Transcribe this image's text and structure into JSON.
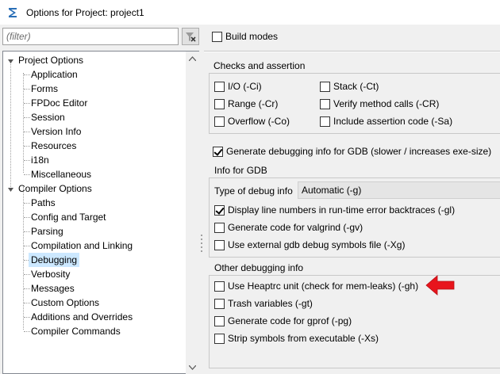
{
  "window": {
    "title": "Options for Project: project1"
  },
  "filter": {
    "placeholder": "(filter)"
  },
  "tree": {
    "project_options": "Project Options",
    "project_children": [
      "Application",
      "Forms",
      "FPDoc Editor",
      "Session",
      "Version Info",
      "Resources",
      "i18n",
      "Miscellaneous"
    ],
    "compiler_options": "Compiler Options",
    "compiler_children": [
      "Paths",
      "Config and Target",
      "Parsing",
      "Compilation and Linking",
      "Debugging",
      "Verbosity",
      "Messages",
      "Custom Options",
      "Additions and Overrides",
      "Compiler Commands"
    ],
    "selected": "Debugging"
  },
  "build_modes": {
    "label": "Build modes",
    "checked": false
  },
  "checks": {
    "title": "Checks and assertion",
    "io": {
      "label": "I/O (-Ci)",
      "checked": false
    },
    "range": {
      "label": "Range (-Cr)",
      "checked": false
    },
    "overflow": {
      "label": "Overflow (-Co)",
      "checked": false
    },
    "stack": {
      "label": "Stack (-Ct)",
      "checked": false
    },
    "verify": {
      "label": "Verify method calls (-CR)",
      "checked": false
    },
    "assertion": {
      "label": "Include assertion code (-Sa)",
      "checked": false
    }
  },
  "gen_debug": {
    "label": "Generate debugging info for GDB (slower / increases exe-size)",
    "checked": true
  },
  "gdb": {
    "title": "Info for GDB",
    "type_label": "Type of debug info",
    "type_value": "Automatic (-g)",
    "line_numbers": {
      "label": "Display line numbers in run-time error backtraces (-gl)",
      "checked": true
    },
    "valgrind": {
      "label": "Generate code for valgrind (-gv)",
      "checked": false
    },
    "external": {
      "label": "Use external gdb debug symbols file (-Xg)",
      "checked": false
    }
  },
  "other": {
    "title": "Other debugging info",
    "heaptrc": {
      "label": "Use Heaptrc unit (check for mem-leaks) (-gh)",
      "checked": false
    },
    "trash": {
      "label": "Trash variables (-gt)",
      "checked": false
    },
    "gprof": {
      "label": "Generate code for gprof (-pg)",
      "checked": false
    },
    "strip": {
      "label": "Strip symbols from executable (-Xs)",
      "checked": false
    }
  },
  "colors": {
    "selection": "#cce8ff",
    "arrow": "#e8141c",
    "app_icon": "#2a6fb7"
  },
  "icons": {
    "app": "lazarus-icon",
    "clear_filter": "clear-filter-icon",
    "annotation": "red-arrow-icon"
  }
}
